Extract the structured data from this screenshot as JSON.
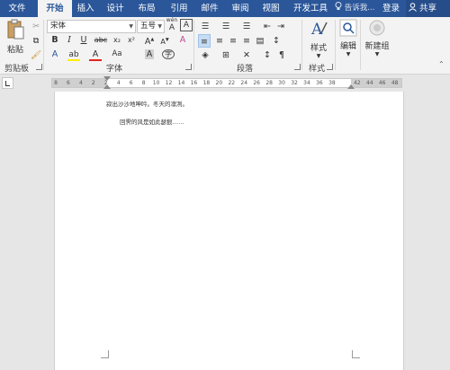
{
  "tabs": [
    {
      "label": "文件",
      "active": false
    },
    {
      "label": "开始",
      "active": true
    },
    {
      "label": "插入",
      "active": false
    },
    {
      "label": "设计",
      "active": false
    },
    {
      "label": "布局",
      "active": false
    },
    {
      "label": "引用",
      "active": false
    },
    {
      "label": "邮件",
      "active": false
    },
    {
      "label": "审阅",
      "active": false
    },
    {
      "label": "视图",
      "active": false
    },
    {
      "label": "开发工具",
      "active": false
    }
  ],
  "tell_me": "告诉我...",
  "login": "登录",
  "share": "共享",
  "clipboard": {
    "paste_label": "粘贴",
    "group_label": "剪贴板"
  },
  "font": {
    "name": "宋体",
    "size": "五号",
    "group_label": "字体",
    "wen_glyph": "A",
    "phonetic_glyph": "wén",
    "bold": "B",
    "italic": "I",
    "underline": "U",
    "strike": "abc",
    "subscript": "x₂",
    "superscript": "x²",
    "highlight_letter": "A",
    "color_letter": "A",
    "case_label": "Aa",
    "grow": "A",
    "shrink": "A"
  },
  "paragraph": {
    "group_label": "段落"
  },
  "styles": {
    "label": "样式",
    "group_label": "样式"
  },
  "editing": {
    "label": "编辑"
  },
  "new_group": {
    "label": "新建组"
  },
  "ruler": {
    "ticks": [
      "8",
      "6",
      "4",
      "2",
      "2",
      "4",
      "6",
      "8",
      "10",
      "12",
      "14",
      "16",
      "18",
      "20",
      "22",
      "24",
      "26",
      "28",
      "30",
      "32",
      "34",
      "36",
      "38",
      "42",
      "44",
      "46",
      "48"
    ]
  },
  "document": {
    "line1": "寂出沙沙地呻吟。冬天的凛冽。",
    "line2": "回霁的风是如此瑟狠……"
  },
  "colors": {
    "accent": "#2b579a",
    "font_color_bar": "#e0261b",
    "highlight_bar": "#ffee00"
  }
}
